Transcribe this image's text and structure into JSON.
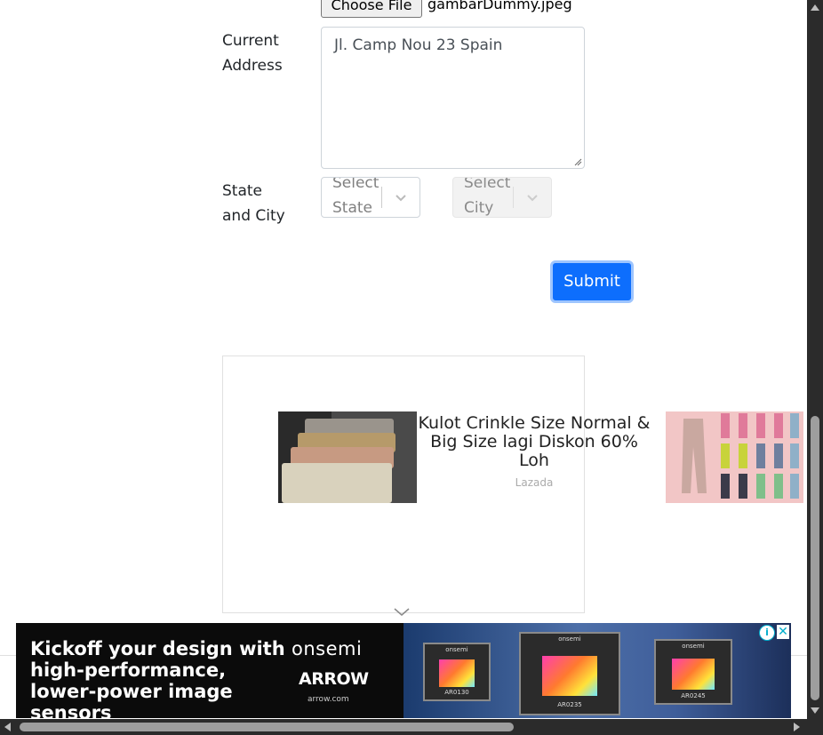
{
  "form": {
    "file": {
      "button_label": "Choose File",
      "file_name": "gambarDummy.jpeg"
    },
    "current_address": {
      "label_line1": "Current",
      "label_line2": "Address",
      "value": "Jl. Camp Nou 23 Spain"
    },
    "state_city": {
      "label_line1": "State",
      "label_line2": "and City",
      "state_placeholder": "Select State",
      "city_placeholder": "Select City",
      "city_disabled": true
    },
    "submit_label": "Submit",
    "accent_color": "#0d6efd"
  },
  "native_ad": {
    "title": "Kulot Crinkle Size Normal & Big Size lagi Diskon 60% Loh",
    "source": "Lazada"
  },
  "banner_ad": {
    "headline": "Kickoff your design with high-performance, lower-power image sensors",
    "brand_primary": "onsemi",
    "brand_secondary": "ARROW",
    "url": "arrow.com",
    "chip_labels": [
      "onsemi",
      "onsemi",
      "onsemi"
    ],
    "chip_codes": [
      "AR0130",
      "AR0235",
      "AR0245"
    ],
    "info_icon": "info-icon",
    "close_icon": "close-icon"
  }
}
